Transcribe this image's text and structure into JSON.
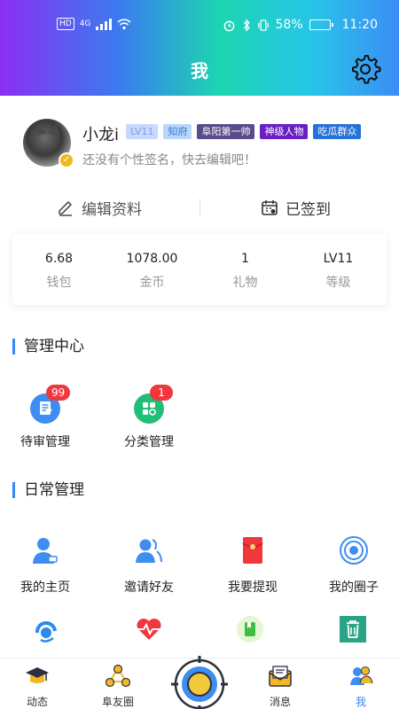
{
  "status_bar": {
    "hd": "HD",
    "net": "4G",
    "battery": "58%",
    "battery_level": 0.58,
    "time": "11:20"
  },
  "header": {
    "title": "我"
  },
  "profile": {
    "name": "小龙i",
    "signature": "还没有个性签名，快去编辑吧！",
    "tags": [
      {
        "text": "LV11",
        "bg": "#c9d8ff",
        "fg": "#7f9be5"
      },
      {
        "text": "知府",
        "bg": "#b9d6fb",
        "fg": "#3f78c8"
      },
      {
        "text": "阜阳第一帅",
        "bg": "#5a4b8c",
        "fg": "#ffffff"
      },
      {
        "text": "神级人物",
        "bg": "#6a1fc6",
        "fg": "#ffffff"
      },
      {
        "text": "吃瓜群众",
        "bg": "#2572d9",
        "fg": "#ffffff"
      }
    ]
  },
  "actions": {
    "edit": "编辑资料",
    "signed": "已签到"
  },
  "stats": [
    {
      "value": "6.68",
      "label": "钱包"
    },
    {
      "value": "1078.00",
      "label": "金币"
    },
    {
      "value": "1",
      "label": "礼物"
    },
    {
      "value": "LV11",
      "label": "等级"
    }
  ],
  "admin": {
    "title": "管理中心",
    "items": [
      {
        "label": "待审管理",
        "badge": "99"
      },
      {
        "label": "分类管理",
        "badge": "1"
      }
    ]
  },
  "daily": {
    "title": "日常管理",
    "items": [
      {
        "label": "我的主页"
      },
      {
        "label": "邀请好友"
      },
      {
        "label": "我要提现"
      },
      {
        "label": "我的圈子"
      }
    ]
  },
  "tabs": [
    {
      "label": "动态"
    },
    {
      "label": "阜友圈"
    },
    {
      "label": "消息"
    },
    {
      "label": "我"
    }
  ],
  "colors": {
    "accent": "#3a86ff",
    "badge": "#f0383c"
  }
}
